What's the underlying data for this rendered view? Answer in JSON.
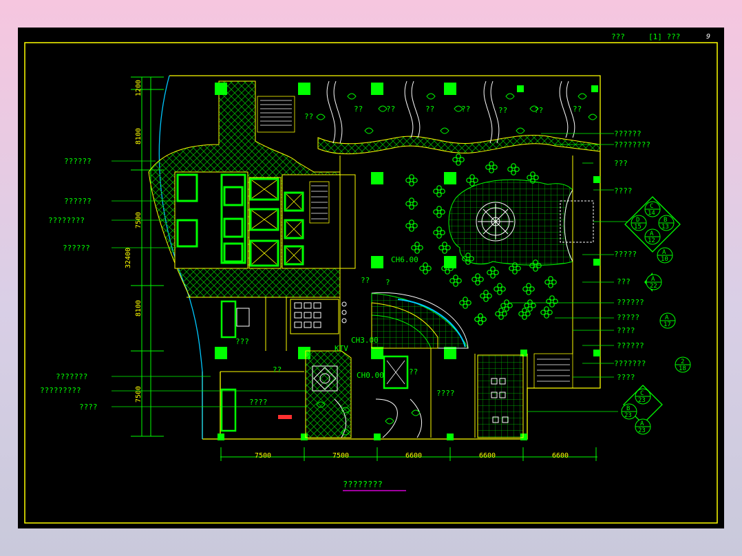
{
  "title_block": {
    "sheet_label": "???",
    "ref": "[1] ???",
    "page": "9"
  },
  "drawing_title": "????????",
  "dims_top": {
    "d1200": "1200",
    "d8100a": "8100",
    "d7500a": "7500",
    "d8100b": "8100",
    "d7500b": "7500",
    "total": "32400"
  },
  "dims_bottom": [
    "7500",
    "7500",
    "6600",
    "6600",
    "6600"
  ],
  "left_callouts": [
    "??????",
    "??????",
    "????????",
    "??????",
    "???????",
    "?????????",
    "????"
  ],
  "right_callouts": [
    "??????",
    "????????",
    "???",
    "????",
    "?????",
    "???",
    "??????",
    "?????",
    "????",
    "??????",
    "???????",
    "????"
  ],
  "room_labels": {
    "ch600": "CH6.00",
    "ch300": "CH3.00",
    "ch000": "CH0.00",
    "ktv": "KTV",
    "r1": "??",
    "r2": "??",
    "r3": "??",
    "r4": "??",
    "r5": "??",
    "r6": "??",
    "r7": "??",
    "r8": "??",
    "r9": "???",
    "r10": "??",
    "r11": "??",
    "r12": "????",
    "r13": "????",
    "r14": "?",
    "r15": "??"
  },
  "section_markers": {
    "top": {
      "c": "C",
      "c_num": "14",
      "d": "D",
      "d_num": "15",
      "b": "B",
      "b_num": "13",
      "a": "A",
      "a_num": "12"
    },
    "m1": {
      "letter": "A",
      "num": "10"
    },
    "m2": {
      "letter": "A",
      "num": "22"
    },
    "m3": {
      "letter": "A",
      "num": "17"
    },
    "m4": {
      "letter": "2",
      "num": "18"
    },
    "bottom": {
      "c": "C",
      "c_num": "23",
      "b": "B",
      "b_num": "23",
      "a": "A",
      "a_num": "23"
    }
  },
  "colors": {
    "line": "#ffff00",
    "accent": "#00ff00",
    "cyan": "#00c8ff",
    "white": "#ffffff",
    "magenta": "#ff00ff"
  }
}
